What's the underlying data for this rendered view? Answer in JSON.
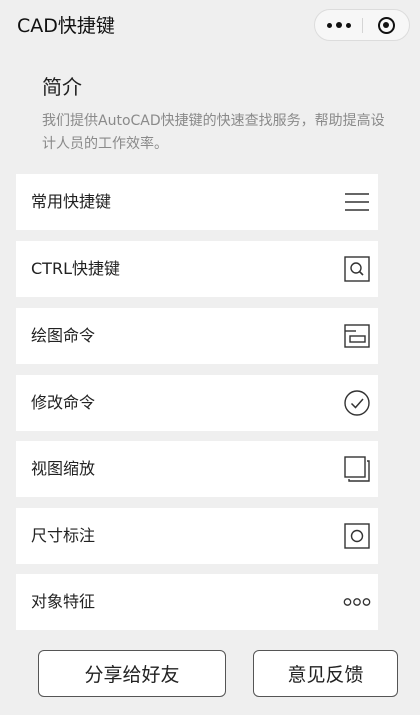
{
  "navbar": {
    "title": "CAD快捷键"
  },
  "intro": {
    "title": "简介",
    "description": "我们提供AutoCAD快捷键的快速查找服务，帮助提高设计人员的工作效率。"
  },
  "menu": [
    {
      "label": "常用快捷键",
      "icon": "hamburger-icon"
    },
    {
      "label": "CTRL快捷键",
      "icon": "search-box-icon"
    },
    {
      "label": "绘图命令",
      "icon": "folder-icon"
    },
    {
      "label": "修改命令",
      "icon": "check-circle-icon"
    },
    {
      "label": "视图缩放",
      "icon": "copy-icon"
    },
    {
      "label": "尺寸标注",
      "icon": "circle-box-icon"
    },
    {
      "label": "对象特征",
      "icon": "more-dots-icon"
    }
  ],
  "buttons": {
    "share": "分享给好友",
    "feedback": "意见反馈"
  }
}
